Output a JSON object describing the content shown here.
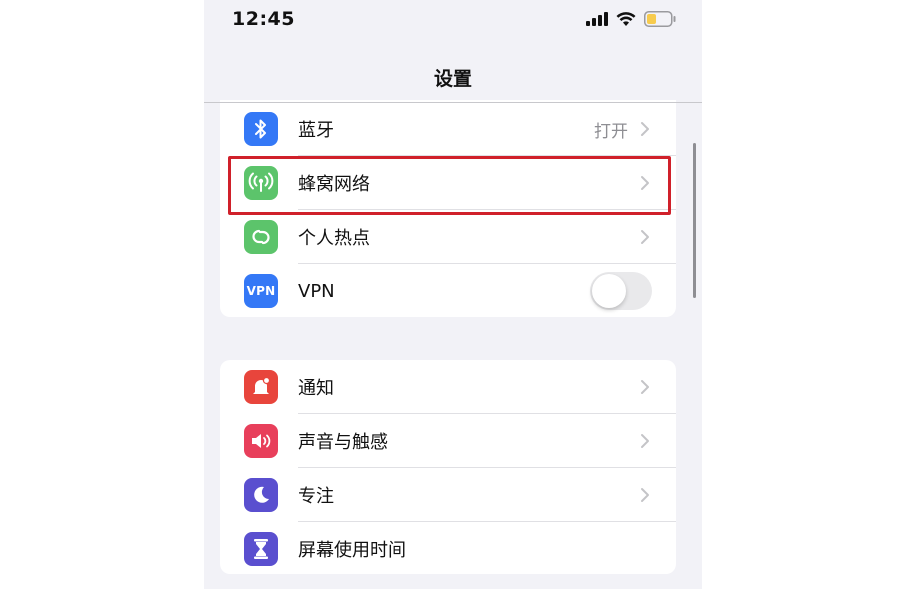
{
  "status_bar": {
    "time": "12:45"
  },
  "nav": {
    "title": "设置"
  },
  "colors": {
    "bluetooth": "#3478f6",
    "cellular": "#5cc46b",
    "hotspot": "#5cc46b",
    "vpn": "#3478f6",
    "notifications": "#e8453c",
    "sounds": "#e83f5b",
    "focus": "#5a4fcf",
    "screen_time": "#5a4fcf",
    "highlight": "#d0202a",
    "battery": "#f7cb4d"
  },
  "group1": {
    "items": [
      {
        "label": "蓝牙",
        "value": "打开",
        "icon": "bluetooth-icon"
      },
      {
        "label": "蜂窝网络",
        "icon": "cellular-antenna-icon"
      },
      {
        "label": "个人热点",
        "icon": "hotspot-link-icon"
      },
      {
        "label": "VPN",
        "icon": "vpn-icon",
        "icon_text": "VPN",
        "toggle_on": false
      }
    ]
  },
  "group2": {
    "items": [
      {
        "label": "通知",
        "icon": "notification-bell-icon"
      },
      {
        "label": "声音与触感",
        "icon": "speaker-icon"
      },
      {
        "label": "专注",
        "icon": "moon-icon"
      },
      {
        "label": "屏幕使用时间",
        "icon": "hourglass-icon"
      }
    ]
  }
}
